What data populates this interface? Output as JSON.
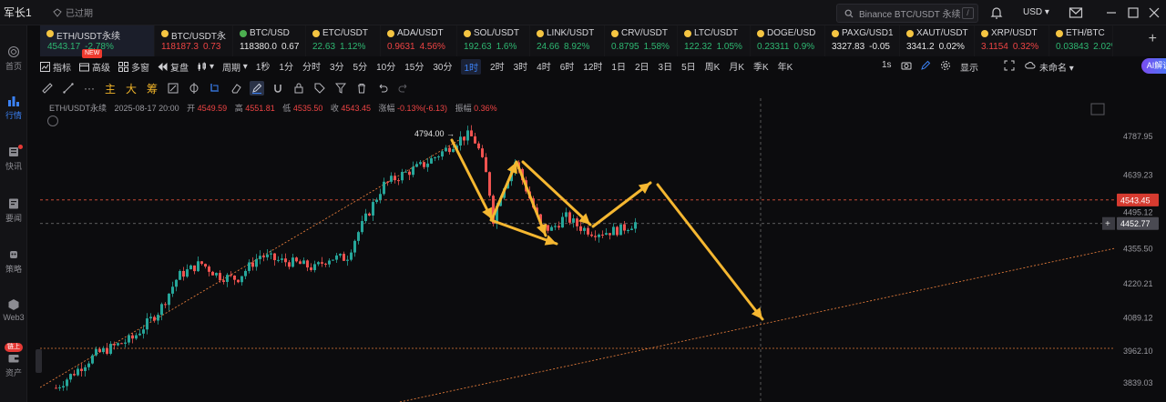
{
  "user": {
    "name": "军长1",
    "status": "已过期"
  },
  "search": {
    "placeholder": "Binance BTC/USDT 永续",
    "shortcut": "/"
  },
  "currency": "USD",
  "nav": [
    {
      "label": "首页",
      "icon": "home-icon"
    },
    {
      "label": "行情",
      "icon": "market-icon"
    },
    {
      "label": "快讯",
      "icon": "news-flash-icon"
    },
    {
      "label": "要闻",
      "icon": "headlines-icon"
    },
    {
      "label": "策略",
      "icon": "strategy-icon"
    },
    {
      "label": "Web3",
      "icon": "web3-icon"
    },
    {
      "label": "资产",
      "icon": "wallet-icon",
      "badge": "链上"
    }
  ],
  "tickers": [
    {
      "symbol": "ETH/USDT永续",
      "price": "4543.17",
      "change": "-2.78%",
      "dir": "up",
      "dot": "#f5c542",
      "active": true,
      "w": 126
    },
    {
      "symbol": "BTC/USDT永",
      "price": "118187.3",
      "change": "0.73",
      "dir": "down",
      "dot": "#f5c542",
      "w": 86
    },
    {
      "symbol": "BTC/USD",
      "price": "118380.0",
      "change": "0.67",
      "dir": "neutral",
      "dot": "#4caf50",
      "w": 80
    },
    {
      "symbol": "ETC/USDT",
      "price": "22.63",
      "change": "1.12%",
      "dir": "up",
      "dot": "#f5c542",
      "w": 82
    },
    {
      "symbol": "ADA/USDT",
      "price": "0.9631",
      "change": "4.56%",
      "dir": "down",
      "dot": "#f5c542",
      "w": 84
    },
    {
      "symbol": "SOL/USDT",
      "price": "192.63",
      "change": "1.6%",
      "dir": "up",
      "dot": "#f5c542",
      "w": 80
    },
    {
      "symbol": "LINK/USDT",
      "price": "24.66",
      "change": "8.92%",
      "dir": "up",
      "dot": "#f5c542",
      "w": 82
    },
    {
      "symbol": "CRV/USDT",
      "price": "0.8795",
      "change": "1.58%",
      "dir": "up",
      "dot": "#f5c542",
      "w": 80
    },
    {
      "symbol": "LTC/USDT",
      "price": "122.32",
      "change": "1.05%",
      "dir": "up",
      "dot": "#f5c542",
      "w": 80
    },
    {
      "symbol": "DOGE/USD",
      "price": "0.23311",
      "change": "0.9%",
      "dir": "up",
      "dot": "#f5c542",
      "w": 82
    },
    {
      "symbol": "PAXG/USD1",
      "price": "3327.83",
      "change": "-0.05",
      "dir": "neutral",
      "dot": "#f5c542",
      "w": 82
    },
    {
      "symbol": "XAUT/USDT",
      "price": "3341.2",
      "change": "0.02%",
      "dir": "neutral",
      "dot": "#f5c542",
      "w": 82
    },
    {
      "symbol": "XRP/USDT",
      "price": "3.1154",
      "change": "0.32%",
      "dir": "down",
      "dot": "#f5c542",
      "w": 82
    },
    {
      "symbol": "ETH/BTC",
      "price": "0.03843",
      "change": "2.02%",
      "dir": "up",
      "dot": "#f5c542",
      "w": 70
    }
  ],
  "new_badge": "NEW",
  "toolbar": {
    "indicator": "指标",
    "advanced": "高级",
    "multi": "多窗",
    "replay": "复盘",
    "period": "周期",
    "intervals": [
      "1秒",
      "1分",
      "分时",
      "3分",
      "5分",
      "10分",
      "15分",
      "30分",
      "1时",
      "2时",
      "3时",
      "4时",
      "6时",
      "12时",
      "1日",
      "2日",
      "3日",
      "5日",
      "周K",
      "月K",
      "季K",
      "年K"
    ],
    "selected_interval": "1时",
    "replay_speed": "1s",
    "display": "显示",
    "unnamed": "未命名",
    "ai": "AI解读"
  },
  "drawbar": [
    "主",
    "大",
    "筹"
  ],
  "legend": {
    "symbol": "ETH/USDT永续",
    "time": "2025-08-17 20:00",
    "open_label": "开",
    "open": "4549.59",
    "high_label": "高",
    "high": "4551.81",
    "low_label": "低",
    "low": "4535.50",
    "close_label": "收",
    "close": "4543.45",
    "change_label": "涨幅",
    "change": "-0.13%(-6.13)",
    "amp_label": "振幅",
    "amp": "0.36%"
  },
  "chart_data": {
    "type": "candlestick",
    "y_ticks": [
      4787.95,
      4639.23,
      4495.12,
      4355.5,
      4220.21,
      4089.12,
      3962.1,
      3839.03
    ],
    "current_price": "4543.45",
    "crosshair_price": "4452.77",
    "high_marker": "4794.00",
    "ylim": [
      3790,
      4860
    ],
    "colors": {
      "up": "#26a69a",
      "down": "#ef5350",
      "annotation": "#f5b731",
      "trend": "#e07a3a"
    }
  }
}
